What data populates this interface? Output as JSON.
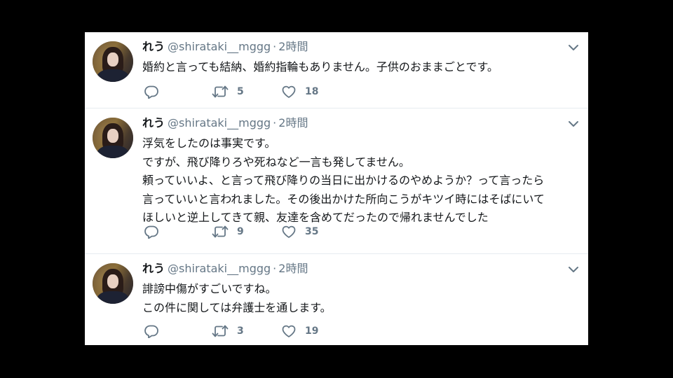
{
  "tweets": [
    {
      "name": "れう",
      "handle": "@shirataki__mggg",
      "separator": "·",
      "time": "2時間",
      "lines": [
        "婚約と言っても結納、婚約指輪もありません。子供のおままごとです。"
      ],
      "retweets": "5",
      "likes": "18"
    },
    {
      "name": "れう",
      "handle": "@shirataki__mggg",
      "separator": "·",
      "time": "2時間",
      "lines": [
        "浮気をしたのは事実です。",
        "ですが、飛び降りろや死ねなど一言も発してません。",
        "頼っていいよ、と言って飛び降りの当日に出かけるのやめようか？って言ったら",
        "言っていいと言われました。その後出かけた所向こうがキツイ時にはそばにいて",
        "ほしいと逆上してきて親、友達を含めてだったので帰れませんでした"
      ],
      "retweets": "9",
      "likes": "35"
    },
    {
      "name": "れう",
      "handle": "@shirataki__mggg",
      "separator": "·",
      "time": "2時間",
      "lines": [
        "誹謗中傷がすごいですね。",
        "この件に関しては弁護士を通します。"
      ],
      "retweets": "3",
      "likes": "19"
    }
  ],
  "icons": {
    "reply": "reply-icon",
    "retweet": "retweet-icon",
    "like": "heart-icon",
    "more": "chevron-down-icon"
  },
  "colors": {
    "background": "#000000",
    "card": "#ffffff",
    "text": "#14171a",
    "muted": "#657786",
    "divider": "#e6ecf0"
  }
}
